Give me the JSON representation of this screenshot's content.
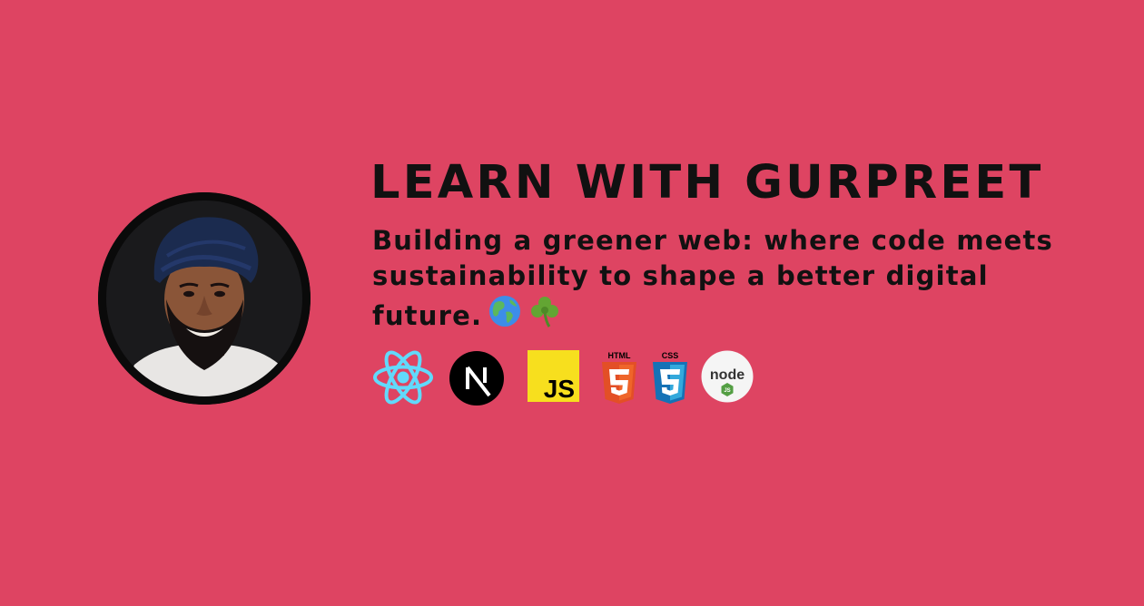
{
  "profile": {
    "title": "LEARN WITH GURPREET",
    "tagline": "Building a greener web: where code meets sustainability to shape a better digital future.",
    "emojis": [
      "globe-americas-icon",
      "shamrock-icon"
    ]
  },
  "tech_stack": [
    {
      "name": "React",
      "icon": "react-icon",
      "color": "#61dafb"
    },
    {
      "name": "Next.js",
      "icon": "nextjs-icon",
      "color": "#000000"
    },
    {
      "name": "JavaScript",
      "icon": "javascript-icon",
      "label": "JS",
      "color": "#f7df1e"
    },
    {
      "name": "HTML5",
      "icon": "html5-icon",
      "label": "HTML",
      "color": "#e34f26"
    },
    {
      "name": "CSS3",
      "icon": "css3-icon",
      "label": "CSS",
      "color": "#1572b6"
    },
    {
      "name": "Node.js",
      "icon": "nodejs-icon",
      "label": "node",
      "color": "#539e43"
    }
  ],
  "colors": {
    "background": "#de4462",
    "text": "#111111"
  }
}
